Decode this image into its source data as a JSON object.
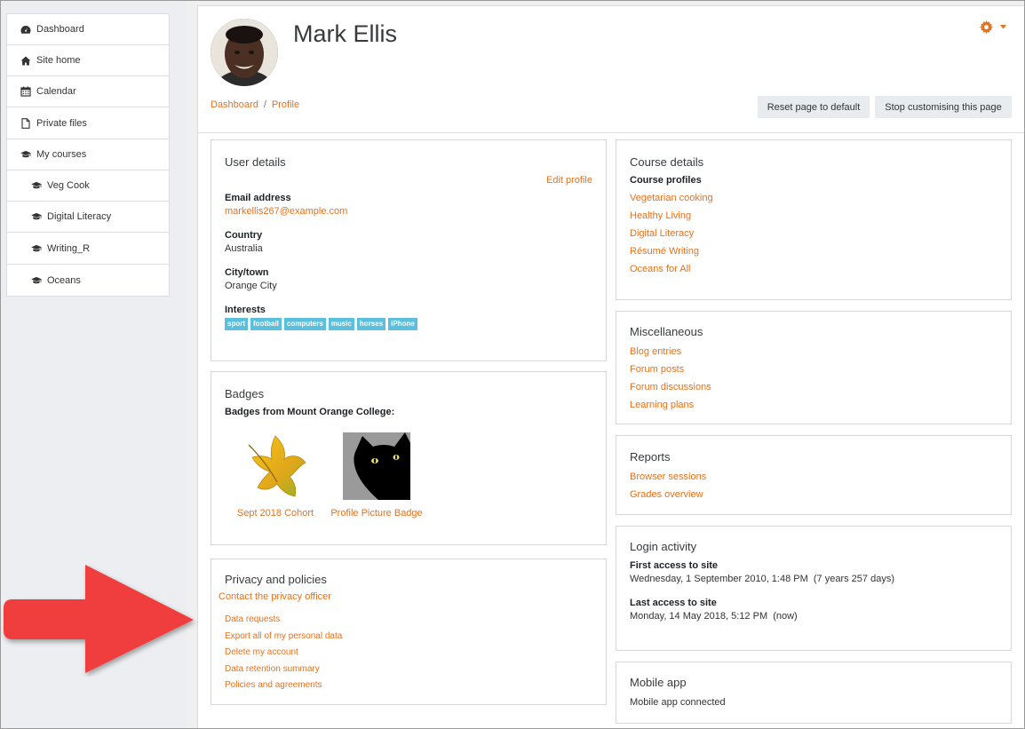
{
  "sidebar": {
    "items": [
      {
        "label": "Dashboard",
        "icon": "dashboard-icon"
      },
      {
        "label": "Site home",
        "icon": "home-icon"
      },
      {
        "label": "Calendar",
        "icon": "calendar-icon"
      },
      {
        "label": "Private files",
        "icon": "file-icon"
      }
    ],
    "courses_label": "My courses",
    "courses": [
      "Veg Cook",
      "Digital Literacy",
      "Writing_R",
      "Oceans"
    ]
  },
  "profile": {
    "name": "Mark Ellis"
  },
  "breadcrumb": {
    "home": "Dashboard",
    "current": "Profile",
    "separator": "/"
  },
  "buttons": {
    "reset": "Reset page to default",
    "stop": "Stop customising this page"
  },
  "user_details": {
    "title": "User details",
    "edit": "Edit profile",
    "email_label": "Email address",
    "email": "markellis267@example.com",
    "country_label": "Country",
    "country": "Australia",
    "city_label": "City/town",
    "city": "Orange City",
    "interests_label": "Interests",
    "interests": [
      "sport",
      "football",
      "computers",
      "music",
      "horses",
      "iPhone"
    ]
  },
  "badges": {
    "title": "Badges",
    "subtitle": "Badges from Mount Orange College:",
    "items": [
      "Sept 2018 Cohort",
      "Profile Picture Badge"
    ]
  },
  "privacy": {
    "title": "Privacy and policies",
    "contact": "Contact the privacy officer",
    "links": [
      "Data requests",
      "Export all of my personal data",
      "Delete my account",
      "Data retention summary",
      "Policies and agreements"
    ]
  },
  "course_details": {
    "title": "Course details",
    "label": "Course profiles",
    "courses": [
      "Vegetarian cooking",
      "Healthy Living",
      "Digital Literacy",
      "Résumé Writing",
      "Oceans for All"
    ]
  },
  "misc": {
    "title": "Miscellaneous",
    "links": [
      "Blog entries",
      "Forum posts",
      "Forum discussions",
      "Learning plans"
    ]
  },
  "reports": {
    "title": "Reports",
    "links": [
      "Browser sessions",
      "Grades overview"
    ]
  },
  "login": {
    "title": "Login activity",
    "first_label": "First access to site",
    "first_value": "Wednesday, 1 September 2010, 1:48 PM  (7 years 257 days)",
    "last_label": "Last access to site",
    "last_value": "Monday, 14 May 2018, 5:12 PM  (now)"
  },
  "mobile": {
    "title": "Mobile app",
    "status": "Mobile app connected"
  },
  "colors": {
    "accent": "#e8711c",
    "tag": "#5bc0de",
    "arrow": "#f03e3e"
  }
}
